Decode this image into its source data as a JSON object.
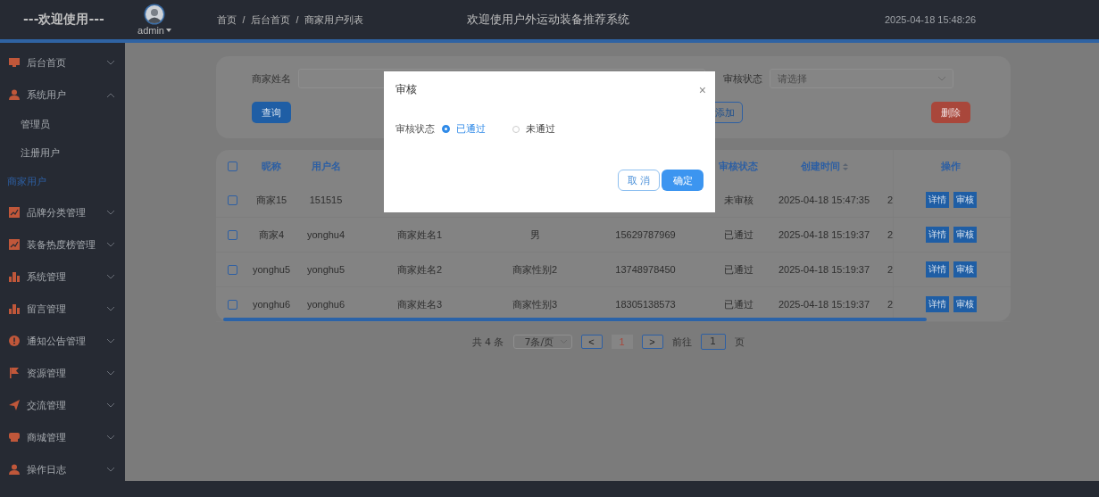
{
  "header": {
    "brand": "---欢迎使用---",
    "user": "admin",
    "breadcrumb": [
      "首页",
      "后台首页",
      "商家用户列表"
    ],
    "title": "欢迎使用户外运动装备推荐系统",
    "datetime": "2025-04-18 15:48:26"
  },
  "sidebar": {
    "items": [
      {
        "label": "后台首页",
        "kind": "monitor",
        "expanded": false,
        "selected": false
      },
      {
        "label": "系统用户",
        "kind": "user",
        "expanded": true,
        "selected": false,
        "children": [
          {
            "label": "管理员",
            "selected": false
          },
          {
            "label": "注册用户",
            "selected": false
          },
          {
            "label": "商家用户",
            "selected": true
          }
        ]
      },
      {
        "label": "品牌分类管理",
        "kind": "chart",
        "expanded": false,
        "selected": false
      },
      {
        "label": "装备热度榜管理",
        "kind": "chart",
        "expanded": false,
        "selected": false
      },
      {
        "label": "系统管理",
        "kind": "bars",
        "expanded": false,
        "selected": false
      },
      {
        "label": "留言管理",
        "kind": "bars",
        "expanded": false,
        "selected": false
      },
      {
        "label": "通知公告管理",
        "kind": "info",
        "expanded": false,
        "selected": false
      },
      {
        "label": "资源管理",
        "kind": "flag",
        "expanded": false,
        "selected": false
      },
      {
        "label": "交流管理",
        "kind": "plane",
        "expanded": false,
        "selected": false
      },
      {
        "label": "商城管理",
        "kind": "store",
        "expanded": false,
        "selected": false
      },
      {
        "label": "操作日志",
        "kind": "user",
        "expanded": false,
        "selected": false
      }
    ]
  },
  "search": {
    "name_label": "商家姓名",
    "status_label": "审核状态",
    "status_placeholder": "请选择",
    "buttons": [
      {
        "label": "查询",
        "kind": "primary"
      },
      {
        "label": "添加",
        "kind": "outline"
      },
      {
        "label": "删除",
        "kind": "danger"
      }
    ]
  },
  "table": {
    "header_checked": false,
    "columns": [
      "昵称",
      "用户名",
      "",
      "",
      "",
      "审核状态",
      "创建时间",
      "",
      "操作"
    ],
    "rows": [
      {
        "checked": false,
        "cells": [
          "商家15",
          "151515",
          "",
          "",
          "",
          "未审核",
          "2025-04-18 15:47:35",
          "2"
        ],
        "actions": [
          "详情",
          "审核"
        ]
      },
      {
        "checked": false,
        "cells": [
          "商家4",
          "yonghu4",
          "商家姓名1",
          "男",
          "15629787969",
          "已通过",
          "2025-04-18 15:19:37",
          "2"
        ],
        "actions": [
          "详情",
          "审核"
        ]
      },
      {
        "checked": false,
        "cells": [
          "yonghu5",
          "yonghu5",
          "商家姓名2",
          "商家性别2",
          "13748978450",
          "已通过",
          "2025-04-18 15:19:37",
          "2"
        ],
        "actions": [
          "详情",
          "审核"
        ]
      },
      {
        "checked": false,
        "cells": [
          "yonghu6",
          "yonghu6",
          "商家姓名3",
          "商家性别3",
          "18305138573",
          "已通过",
          "2025-04-18 15:19:37",
          "2"
        ],
        "actions": [
          "详情",
          "审核"
        ]
      }
    ]
  },
  "pagination": {
    "total": "共 4 条",
    "page_size": "7条/页",
    "prev": "<",
    "pages": [
      {
        "label": "1",
        "selected": true
      }
    ],
    "next": ">",
    "goto_label": "前往",
    "goto_value": "1",
    "goto_suffix": "页"
  },
  "dialog": {
    "title": "审核",
    "close": "×",
    "field_label": "审核状态",
    "options": [
      {
        "label": "已通过",
        "selected": true
      },
      {
        "label": "未通过",
        "selected": false
      }
    ],
    "cancel": "取 消",
    "confirm": "确定"
  }
}
